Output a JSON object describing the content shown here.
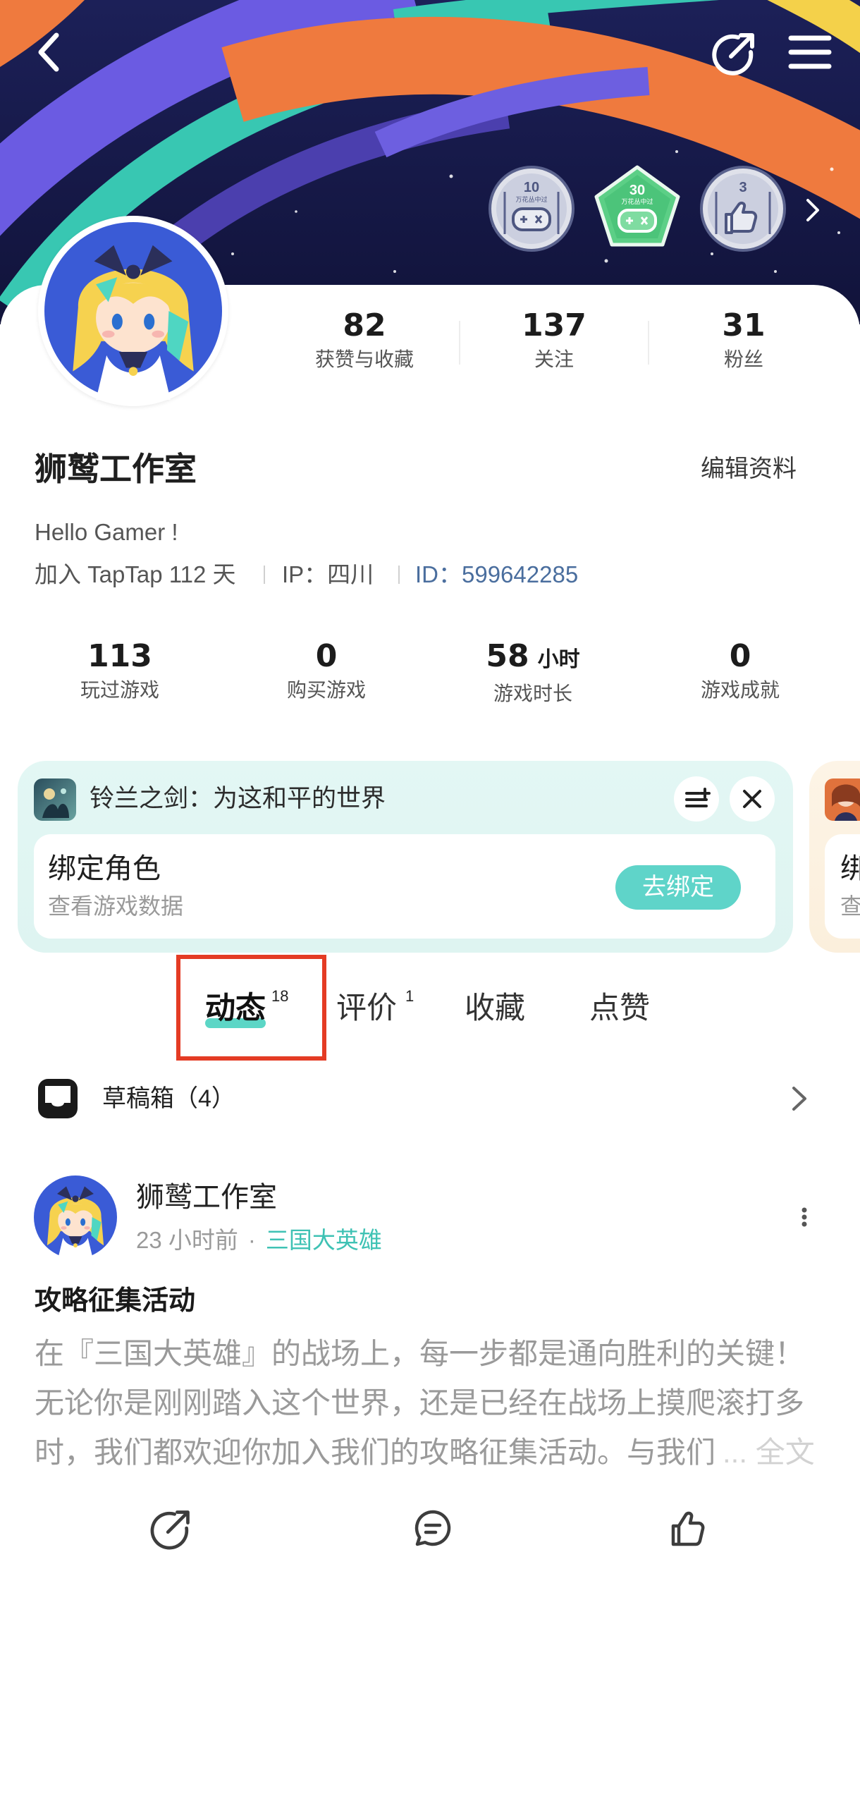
{
  "header": {
    "icons": {
      "back": "back-arrow-icon",
      "share": "share-icon",
      "menu": "menu-icon",
      "more_badges": "chevron-right-icon"
    }
  },
  "badges": [
    {
      "number": "10",
      "caption": "万花丛中过",
      "icon": "gamepad-icon"
    },
    {
      "number": "30",
      "caption": "万花丛中过",
      "icon": "gamepad-icon"
    },
    {
      "number": "3",
      "icon": "thumbs-up-icon"
    }
  ],
  "profile": {
    "name": "狮鹫工作室",
    "edit_label": "编辑资料",
    "bio": "Hello Gamer !",
    "joined": "加入 TapTap 112 天",
    "ip": "IP：四川",
    "id_label": "ID：",
    "id_value": "599642285"
  },
  "social_stats": [
    {
      "value": "82",
      "label": "获赞与收藏"
    },
    {
      "value": "137",
      "label": "关注"
    },
    {
      "value": "31",
      "label": "粉丝"
    }
  ],
  "game_stats": [
    {
      "value": "113",
      "label": "玩过游戏"
    },
    {
      "value": "0",
      "label": "购买游戏"
    },
    {
      "value": "58",
      "unit": "小时",
      "label": "游戏时长"
    },
    {
      "value": "0",
      "label": "游戏成就"
    }
  ],
  "game_cards": [
    {
      "title": "铃兰之剑：为这和平的世界",
      "bind_title": "绑定角色",
      "bind_sub": "查看游戏数据",
      "bind_button": "去绑定"
    },
    {
      "bind_title": "绑",
      "bind_sub": "查"
    }
  ],
  "tabs": [
    {
      "label": "动态",
      "count": "18",
      "active": true
    },
    {
      "label": "评价",
      "count": "1",
      "active": false
    },
    {
      "label": "收藏",
      "active": false
    },
    {
      "label": "点赞",
      "active": false
    }
  ],
  "drafts": {
    "label": "草稿箱（4）"
  },
  "post": {
    "author": "狮鹫工作室",
    "time": "23 小时前",
    "separator": "·",
    "topic": "三国大英雄",
    "title": "攻略征集活动",
    "body_lines": [
      "在『三国大英雄』的战场上，每一步都是通向胜利的关键！",
      "无论你是刚刚踏入这个世界，还是已经在战场上摸爬滚打多",
      "时，我们都欢迎你加入我们的攻略征集活动。与我们"
    ],
    "expand_label": "... 全文",
    "actions": [
      "share-icon",
      "comment-icon",
      "like-icon"
    ]
  },
  "colors": {
    "accent": "#5fd4c9",
    "topic": "#3fc2b4",
    "id_link": "#4a6e9e",
    "annotation": "#e43b24",
    "banner_navy": "#161a4d"
  }
}
